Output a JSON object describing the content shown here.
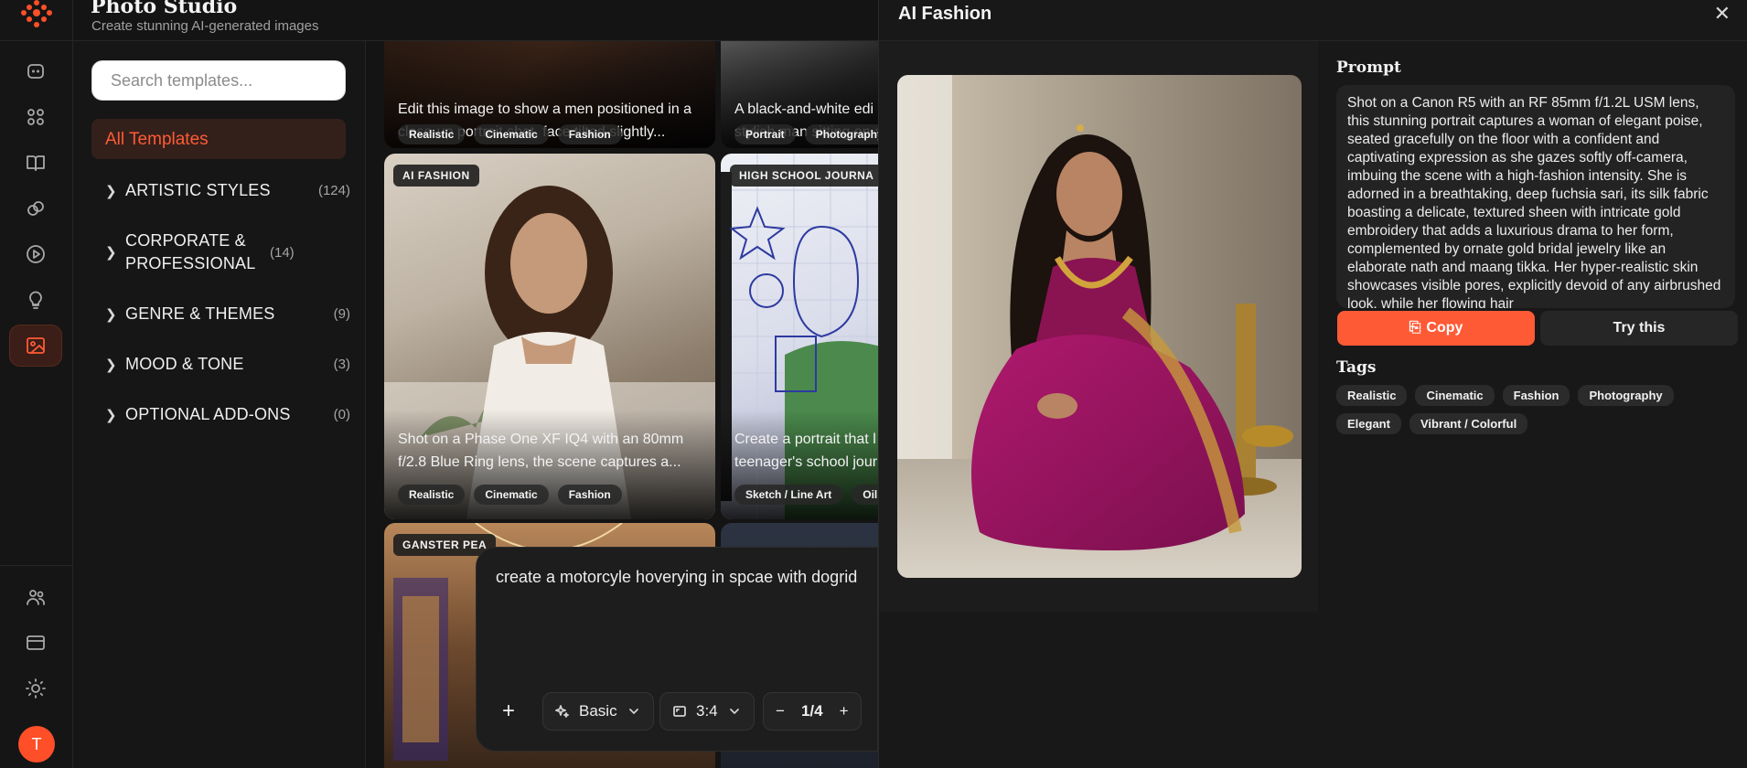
{
  "header": {
    "title": "Photo Studio",
    "subtitle": "Create stunning AI-generated images"
  },
  "rail": {
    "items": [
      {
        "name": "rail-chat",
        "icon": "bot-icon"
      },
      {
        "name": "rail-apps",
        "icon": "grid-icon"
      },
      {
        "name": "rail-library",
        "icon": "book-icon"
      },
      {
        "name": "rail-links",
        "icon": "link-icon"
      },
      {
        "name": "rail-video",
        "icon": "play-icon"
      },
      {
        "name": "rail-ideas",
        "icon": "bulb-icon"
      },
      {
        "name": "rail-photo",
        "icon": "image-icon"
      }
    ],
    "bottom": [
      {
        "name": "rail-team",
        "icon": "users-icon"
      },
      {
        "name": "rail-billing",
        "icon": "card-icon"
      },
      {
        "name": "rail-theme",
        "icon": "sun-icon"
      }
    ],
    "avatar_letter": "T"
  },
  "templates": {
    "search_placeholder": "Search templates...",
    "all_label": "All Templates",
    "categories": [
      {
        "label": "ARTISTIC STYLES",
        "count": "(124)"
      },
      {
        "label": "CORPORATE & PROFESSIONAL",
        "count": "(14)"
      },
      {
        "label": "GENRE & THEMES",
        "count": "(9)"
      },
      {
        "label": "MOOD & TONE",
        "count": "(3)"
      },
      {
        "label": "OPTIONAL ADD-ONS",
        "count": "(0)"
      }
    ]
  },
  "gallery": {
    "cards": [
      {
        "badge": "",
        "desc": "Edit this image to show a men positioned in a close-up portrait shot, face tilted slightly...",
        "tags": [
          "Realistic",
          "Cinematic",
          "Fashion"
        ]
      },
      {
        "badge": "",
        "desc": "A black-and-white edi stylish man sitting on a",
        "tags": [
          "Portrait",
          "Photography"
        ]
      },
      {
        "badge": "AI FASHION",
        "desc": "Shot on a Phase One XF IQ4 with an 80mm f/2.8 Blue Ring lens, the scene captures a...",
        "tags": [
          "Realistic",
          "Cinematic",
          "Fashion"
        ]
      },
      {
        "badge": "HIGH SCHOOL JOURNA",
        "desc": "Create a portrait that l teenager's school jour",
        "tags": [
          "Sketch / Line Art",
          "Oil Pa"
        ]
      },
      {
        "badge": "GANSTER PEA",
        "desc": "",
        "tags": []
      }
    ]
  },
  "prompt": {
    "text": "create a motorcyle hoverying in spcae with dogrid",
    "mode": "Basic",
    "ratio": "3:4",
    "count": "1/4"
  },
  "detail": {
    "title": "AI Fashion",
    "prompt_label": "Prompt",
    "prompt_text": "Shot on a Canon R5 with an RF 85mm f/1.2L USM lens, this stunning portrait captures a woman of elegant poise, seated gracefully on the floor with a confident and captivating expression as she gazes softly off-camera, imbuing the scene with a high-fashion intensity. She is adorned in a breathtaking, deep fuchsia sari, its silk fabric boasting a delicate, textured sheen with intricate gold embroidery that adds a luxurious drama to her form, complemented by ornate gold bridal jewelry like an elaborate nath and maang tikka. Her hyper-realistic skin showcases visible pores, explicitly devoid of any airbrushed look, while her flowing hair",
    "copy_label": "Copy",
    "try_label": "Try this",
    "tags_label": "Tags",
    "tags": [
      "Realistic",
      "Cinematic",
      "Fashion",
      "Photography",
      "Elegant",
      "Vibrant / Colorful"
    ]
  },
  "colors": {
    "accent": "#ff5a36",
    "background": "#141414",
    "panel": "#181818"
  }
}
